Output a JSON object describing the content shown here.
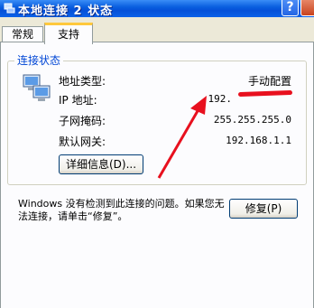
{
  "window": {
    "title": "本地连接 2 状态"
  },
  "tabs": [
    {
      "label": "常规"
    },
    {
      "label": "支持"
    }
  ],
  "connection": {
    "group_title": "连接状态",
    "rows": [
      {
        "label": "地址类型:",
        "value": "手动配置"
      },
      {
        "label": "IP 地址:",
        "value": "192."
      },
      {
        "label": "子网掩码:",
        "value": "255.255.255.0"
      },
      {
        "label": "默认网关:",
        "value": "192.168.1.1"
      }
    ],
    "details_button": "详细信息(D)..."
  },
  "message": "Windows 没有检测到此连接的问题。如果您无法连接，请单击“修复”。",
  "repair_button": "修复(P)",
  "colors": {
    "title_bar": "#0a5fe0",
    "annotation": "#e8101e",
    "legend": "#0046d5"
  }
}
